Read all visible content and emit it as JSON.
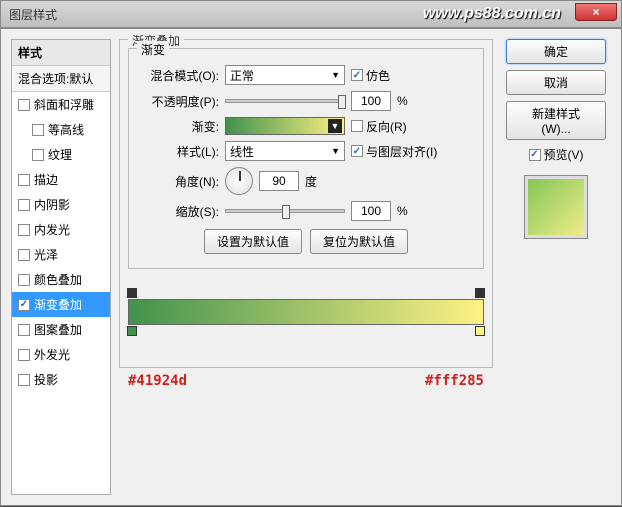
{
  "titlebar": {
    "title": "图层样式",
    "watermark": "www.ps88.com.cn",
    "close": "×"
  },
  "left": {
    "header": "样式",
    "sub": "混合选项:默认",
    "items": [
      {
        "label": "斜面和浮雕",
        "checked": false,
        "indent": false
      },
      {
        "label": "等高线",
        "checked": false,
        "indent": true
      },
      {
        "label": "纹理",
        "checked": false,
        "indent": true
      },
      {
        "label": "描边",
        "checked": false,
        "indent": false
      },
      {
        "label": "内阴影",
        "checked": false,
        "indent": false
      },
      {
        "label": "内发光",
        "checked": false,
        "indent": false
      },
      {
        "label": "光泽",
        "checked": false,
        "indent": false
      },
      {
        "label": "颜色叠加",
        "checked": false,
        "indent": false
      },
      {
        "label": "渐变叠加",
        "checked": true,
        "indent": false,
        "selected": true
      },
      {
        "label": "图案叠加",
        "checked": false,
        "indent": false
      },
      {
        "label": "外发光",
        "checked": false,
        "indent": false
      },
      {
        "label": "投影",
        "checked": false,
        "indent": false
      }
    ]
  },
  "center": {
    "outer_legend": "渐变叠加",
    "inner_legend": "渐变",
    "blend_label": "混合模式(O):",
    "blend_value": "正常",
    "dither_label": "仿色",
    "dither_checked": true,
    "opacity_label": "不透明度(P):",
    "opacity_value": "100",
    "pct": "%",
    "grad_label": "渐变:",
    "reverse_label": "反向(R)",
    "reverse_checked": false,
    "style_label": "样式(L):",
    "style_value": "线性",
    "align_label": "与图层对齐(I)",
    "align_checked": true,
    "angle_label": "角度(N):",
    "angle_value": "90",
    "angle_unit": "度",
    "scale_label": "缩放(S):",
    "scale_value": "100",
    "btn_default": "设置为默认值",
    "btn_reset": "复位为默认值"
  },
  "right": {
    "ok": "确定",
    "cancel": "取消",
    "new": "新建样式(W)...",
    "preview_label": "预览(V)",
    "preview_checked": true
  },
  "gradient": {
    "hex_left": "#41924d",
    "hex_right": "#fff285"
  },
  "chart_data": {
    "type": "gradient",
    "stops": [
      {
        "position": 0,
        "color": "#41924d"
      },
      {
        "position": 100,
        "color": "#fff285"
      }
    ],
    "opacity_stops": [
      {
        "position": 0,
        "opacity": 100
      },
      {
        "position": 100,
        "opacity": 100
      }
    ]
  }
}
